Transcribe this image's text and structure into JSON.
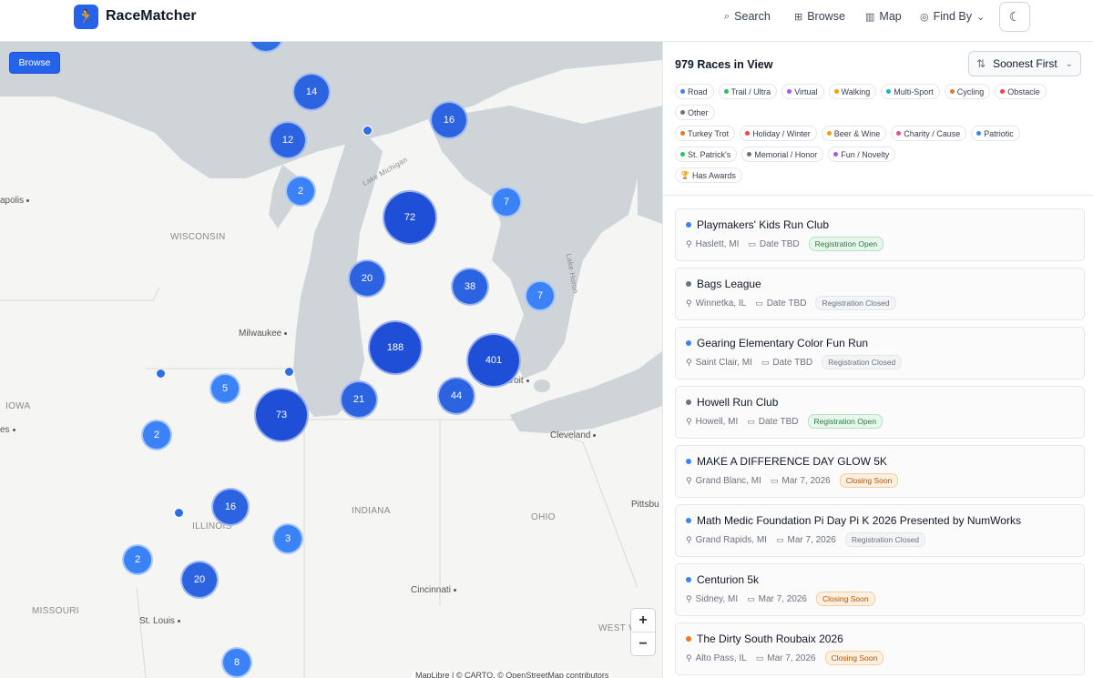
{
  "header": {
    "brand": "RaceMatcher",
    "nav": [
      {
        "label": "Search",
        "icon": "search-icon",
        "glyph": "⌕"
      },
      {
        "label": "Browse",
        "icon": "grid-icon",
        "glyph": "⊞"
      },
      {
        "label": "Map",
        "icon": "map-icon",
        "glyph": "▥"
      },
      {
        "label": "Find By",
        "icon": "compass-icon",
        "glyph": "◎"
      }
    ],
    "find_by_chevron": "⌄",
    "theme_glyph": "☾"
  },
  "map": {
    "browse_label": "Browse",
    "regions": [
      "WISCONSIN",
      "IOWA",
      "ILLINOIS",
      "INDIANA",
      "OHIO",
      "MISSOURI",
      "WEST V"
    ],
    "cities": [
      "Milwaukee",
      "Cleveland",
      "Cincinnati",
      "St. Louis",
      "apolis",
      "Pittsbu",
      "troit",
      "es"
    ],
    "lake_labels": [
      "Lake Michigan",
      "Lake Huron"
    ],
    "clusters": [
      "14",
      "16",
      "12",
      "2",
      "72",
      "7",
      "20",
      "38",
      "7",
      "188",
      "401",
      "5",
      "73",
      "21",
      "44",
      "2",
      "16",
      "3",
      "2",
      "20",
      "8"
    ],
    "zoom_in": "+",
    "zoom_out": "−",
    "attribution": "MapLibre | © CARTO, © OpenStreetMap contributors"
  },
  "sidebar": {
    "count_label": "979 Races in View",
    "sort_label": "Soonest First",
    "sort_glyph": "⇅",
    "sort_chevron": "⌄",
    "filter_rows": [
      [
        {
          "label": "Road",
          "color": "#3b82f6"
        },
        {
          "label": "Trail / Ultra",
          "color": "#22c55e"
        },
        {
          "label": "Virtual",
          "color": "#a855f7"
        },
        {
          "label": "Walking",
          "color": "#f59e0b"
        },
        {
          "label": "Multi-Sport",
          "color": "#06b6d4"
        },
        {
          "label": "Cycling",
          "color": "#f97316"
        },
        {
          "label": "Obstacle",
          "color": "#ef4444"
        }
      ],
      [
        {
          "label": "Other",
          "color": "#6b7280"
        }
      ],
      [
        {
          "label": "Turkey Trot",
          "color": "#f97316"
        },
        {
          "label": "Holiday / Winter",
          "color": "#ef4444"
        },
        {
          "label": "Beer & Wine",
          "color": "#f59e0b"
        },
        {
          "label": "Charity / Cause",
          "color": "#ec4899"
        },
        {
          "label": "Patriotic",
          "color": "#3b82f6"
        }
      ],
      [
        {
          "label": "St. Patrick's",
          "color": "#22c55e"
        },
        {
          "label": "Memorial / Honor",
          "color": "#6b7280"
        },
        {
          "label": "Fun / Novelty",
          "color": "#a855f7"
        }
      ]
    ],
    "awards_label": "Has Awards",
    "races": [
      {
        "name": "Playmakers' Kids Run Club",
        "location": "Haslett, MI",
        "date": "Date TBD",
        "status": "Registration Open",
        "status_type": "open",
        "color": "#3b82f6"
      },
      {
        "name": "Bags League",
        "location": "Winnetka, IL",
        "date": "Date TBD",
        "status": "Registration Closed",
        "status_type": "closed",
        "color": "#6b7280"
      },
      {
        "name": "Gearing Elementary Color Fun Run",
        "location": "Saint Clair, MI",
        "date": "Date TBD",
        "status": "Registration Closed",
        "status_type": "closed",
        "color": "#3b82f6"
      },
      {
        "name": "Howell Run Club",
        "location": "Howell, MI",
        "date": "Date TBD",
        "status": "Registration Open",
        "status_type": "open",
        "color": "#6b7280"
      },
      {
        "name": "MAKE A DIFFERENCE DAY GLOW 5K",
        "location": "Grand Blanc, MI",
        "date": "Mar 7, 2026",
        "status": "Closing Soon",
        "status_type": "soon",
        "color": "#3b82f6"
      },
      {
        "name": "Math Medic Foundation Pi Day Pi K 2026 Presented by NumWorks",
        "location": "Grand Rapids, MI",
        "date": "Mar 7, 2026",
        "status": "Registration Closed",
        "status_type": "closed",
        "color": "#3b82f6"
      },
      {
        "name": "Centurion 5k",
        "location": "Sidney, MI",
        "date": "Mar 7, 2026",
        "status": "Closing Soon",
        "status_type": "soon",
        "color": "#3b82f6"
      },
      {
        "name": "The Dirty South Roubaix 2026",
        "location": "Alto Pass, IL",
        "date": "Mar 7, 2026",
        "status": "Closing Soon",
        "status_type": "soon",
        "color": "#f97316"
      }
    ]
  }
}
